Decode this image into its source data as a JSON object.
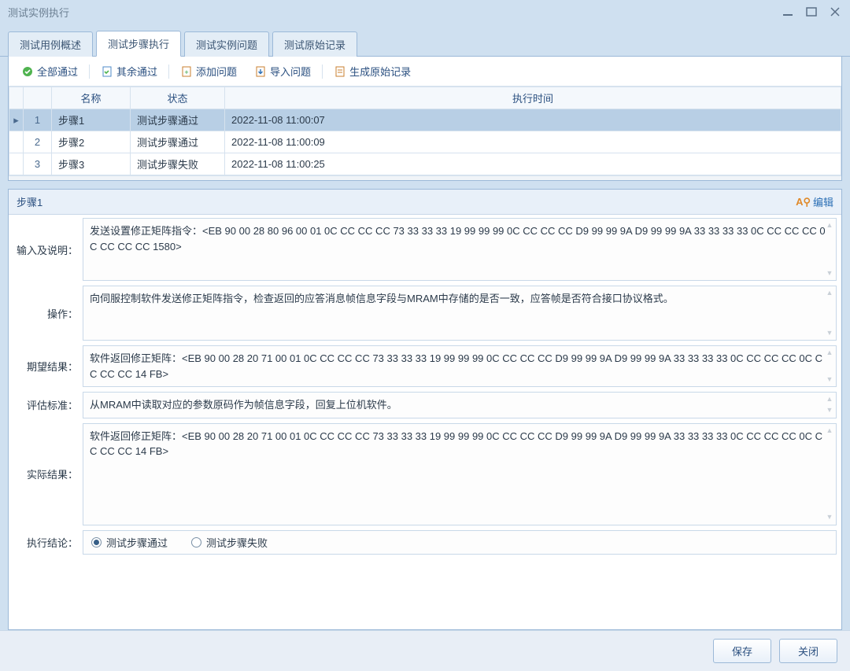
{
  "window": {
    "title": "测试实例执行"
  },
  "tabs": [
    {
      "label": "测试用例概述"
    },
    {
      "label": "测试步骤执行"
    },
    {
      "label": "测试实例问题"
    },
    {
      "label": "测试原始记录"
    }
  ],
  "toolbar": {
    "pass_all": "全部通过",
    "pass_rest": "其余通过",
    "add_issue": "添加问题",
    "import_issue": "导入问题",
    "gen_raw": "生成原始记录"
  },
  "table": {
    "headers": {
      "name": "名称",
      "status": "状态",
      "time": "执行时间"
    },
    "rows": [
      {
        "idx": "1",
        "marker": "▸",
        "name": "步骤1",
        "status": "测试步骤通过",
        "time": "2022-11-08 11:00:07",
        "selected": true
      },
      {
        "idx": "2",
        "marker": "",
        "name": "步骤2",
        "status": "测试步骤通过",
        "time": "2022-11-08 11:00:09",
        "selected": false
      },
      {
        "idx": "3",
        "marker": "",
        "name": "步骤3",
        "status": "测试步骤失败",
        "time": "2022-11-08 11:00:25",
        "selected": false
      }
    ]
  },
  "detail": {
    "step_label": "步骤1",
    "edit_label": "编辑",
    "labels": {
      "input_desc": "输入及说明：",
      "operation": "操作：",
      "expected": "期望结果：",
      "criteria": "评估标准：",
      "actual": "实际结果：",
      "conclusion": "执行结论："
    },
    "values": {
      "input_desc": "发送设置修正矩阵指令：<EB 90 00 28 80 96 00 01 0C CC CC CC 73 33 33 33 19 99 99 99 0C CC CC CC D9 99 99 9A D9 99 99 9A 33 33 33 33 0C CC CC CC 0C CC CC CC  1580>",
      "operation": "向伺服控制软件发送修正矩阵指令，检查返回的应答消息帧信息字段与MRAM中存储的是否一致，应答帧是否符合接口协议格式。",
      "expected": "软件返回修正矩阵：<EB 90 00 28 20 71 00 01 0C CC CC CC 73 33 33 33 19 99 99 99 0C CC CC CC D9 99 99 9A D9 99 99 9A 33 33 33 33 0C CC CC CC 0C CC CC CC 14 FB>",
      "criteria": "从MRAM中读取对应的参数原码作为帧信息字段，回复上位机软件。",
      "actual": "软件返回修正矩阵：<EB 90 00 28 20 71 00 01 0C CC CC CC 73 33 33 33 19 99 99 99 0C CC CC CC D9 99 99 9A D9 99 99 9A 33 33 33 33 0C CC CC CC 0C CC CC CC 14 FB>"
    },
    "conclusion_options": {
      "pass": "测试步骤通过",
      "fail": "测试步骤失败"
    },
    "conclusion_selected": "pass"
  },
  "footer": {
    "save": "保存",
    "close": "关闭"
  }
}
